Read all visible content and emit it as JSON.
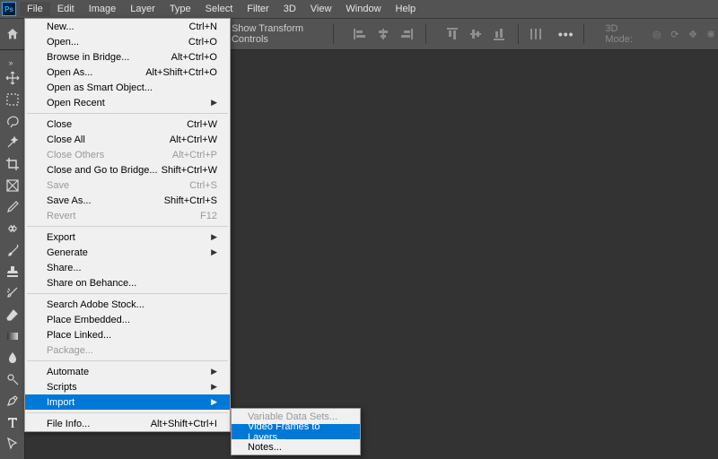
{
  "app": {
    "logo": "Ps"
  },
  "menubar": {
    "items": [
      "File",
      "Edit",
      "Image",
      "Layer",
      "Type",
      "Select",
      "Filter",
      "3D",
      "View",
      "Window",
      "Help"
    ],
    "active": "File"
  },
  "optionsBar": {
    "transformLabel": "Show Transform Controls",
    "modeLabel": "3D Mode:",
    "more": "•••"
  },
  "fileMenu": {
    "groups": [
      [
        {
          "label": "New...",
          "shortcut": "Ctrl+N"
        },
        {
          "label": "Open...",
          "shortcut": "Ctrl+O"
        },
        {
          "label": "Browse in Bridge...",
          "shortcut": "Alt+Ctrl+O"
        },
        {
          "label": "Open As...",
          "shortcut": "Alt+Shift+Ctrl+O"
        },
        {
          "label": "Open as Smart Object..."
        },
        {
          "label": "Open Recent",
          "submenu": true
        }
      ],
      [
        {
          "label": "Close",
          "shortcut": "Ctrl+W"
        },
        {
          "label": "Close All",
          "shortcut": "Alt+Ctrl+W"
        },
        {
          "label": "Close Others",
          "shortcut": "Alt+Ctrl+P",
          "disabled": true
        },
        {
          "label": "Close and Go to Bridge...",
          "shortcut": "Shift+Ctrl+W"
        },
        {
          "label": "Save",
          "shortcut": "Ctrl+S",
          "disabled": true
        },
        {
          "label": "Save As...",
          "shortcut": "Shift+Ctrl+S"
        },
        {
          "label": "Revert",
          "shortcut": "F12",
          "disabled": true
        }
      ],
      [
        {
          "label": "Export",
          "submenu": true
        },
        {
          "label": "Generate",
          "submenu": true
        },
        {
          "label": "Share..."
        },
        {
          "label": "Share on Behance..."
        }
      ],
      [
        {
          "label": "Search Adobe Stock..."
        },
        {
          "label": "Place Embedded..."
        },
        {
          "label": "Place Linked..."
        },
        {
          "label": "Package...",
          "disabled": true
        }
      ],
      [
        {
          "label": "Automate",
          "submenu": true
        },
        {
          "label": "Scripts",
          "submenu": true
        },
        {
          "label": "Import",
          "submenu": true,
          "highlight": true
        }
      ],
      [
        {
          "label": "File Info...",
          "shortcut": "Alt+Shift+Ctrl+I"
        }
      ]
    ]
  },
  "importSubmenu": {
    "items": [
      {
        "label": "Variable Data Sets...",
        "disabled": true
      },
      {
        "label": "Video Frames to Layers...",
        "highlight": true
      },
      {
        "label": "Notes..."
      }
    ]
  },
  "tools": [
    "move",
    "marquee",
    "lasso",
    "wand",
    "crop",
    "frame",
    "eyedrop",
    "heal",
    "brush",
    "stamp",
    "history",
    "eraser",
    "gradient",
    "blur",
    "dodge",
    "pen",
    "type",
    "path"
  ]
}
